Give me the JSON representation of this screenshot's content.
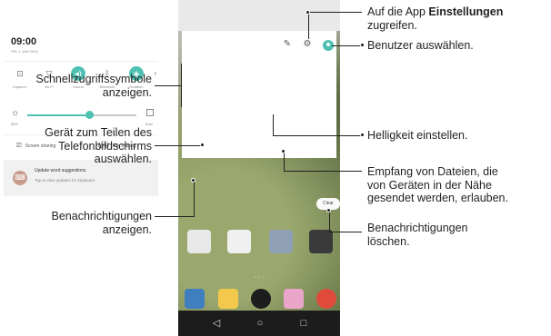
{
  "callouts": {
    "settings_line1_pre": "Auf die App ",
    "settings_line1_bold": "Einstellungen",
    "settings_line2": "zugreifen.",
    "user": "Benutzer auswählen.",
    "quick_line1": "Schnellzugriffssymbole",
    "quick_line2": "anzeigen.",
    "brightness": "Helligkeit einstellen.",
    "share_line1": "Gerät zum Teilen des",
    "share_line2": "Telefonbildschirms",
    "share_line3": "auswählen.",
    "files_line1": "Empfang von Dateien, die",
    "files_line2": "von Geräten in der Nähe",
    "files_line3": "gesendet werden, erlauben.",
    "clear_line1": "Benachrichtigungen",
    "clear_line2": "löschen.",
    "notif_line1": "Benachrichtigungen",
    "notif_line2": "anzeigen."
  },
  "phone": {
    "time": "09:00",
    "date": "FRI, 1 JAN 2016",
    "quick_settings": [
      {
        "label": "Capture+",
        "icon": "capture-icon",
        "on": false
      },
      {
        "label": "Wi-Fi",
        "icon": "wifi-icon",
        "on": false
      },
      {
        "label": "Sound",
        "icon": "sound-icon",
        "on": true
      },
      {
        "label": "Bluetooth",
        "icon": "bluetooth-icon",
        "on": false
      },
      {
        "label": "Rotation",
        "icon": "rotation-icon",
        "on": true
      }
    ],
    "brightness": {
      "level": 0.57,
      "percent_label": "58%",
      "auto_label": "Auto"
    },
    "share": {
      "screen_sharing": "Screen sharing",
      "file_sharing": "File sharing"
    },
    "notification": {
      "title": "Update word suggestions",
      "body": "Tap to view updates for keyboard"
    },
    "clear_label": "Clear",
    "accent_color": "#4ec1b2"
  }
}
